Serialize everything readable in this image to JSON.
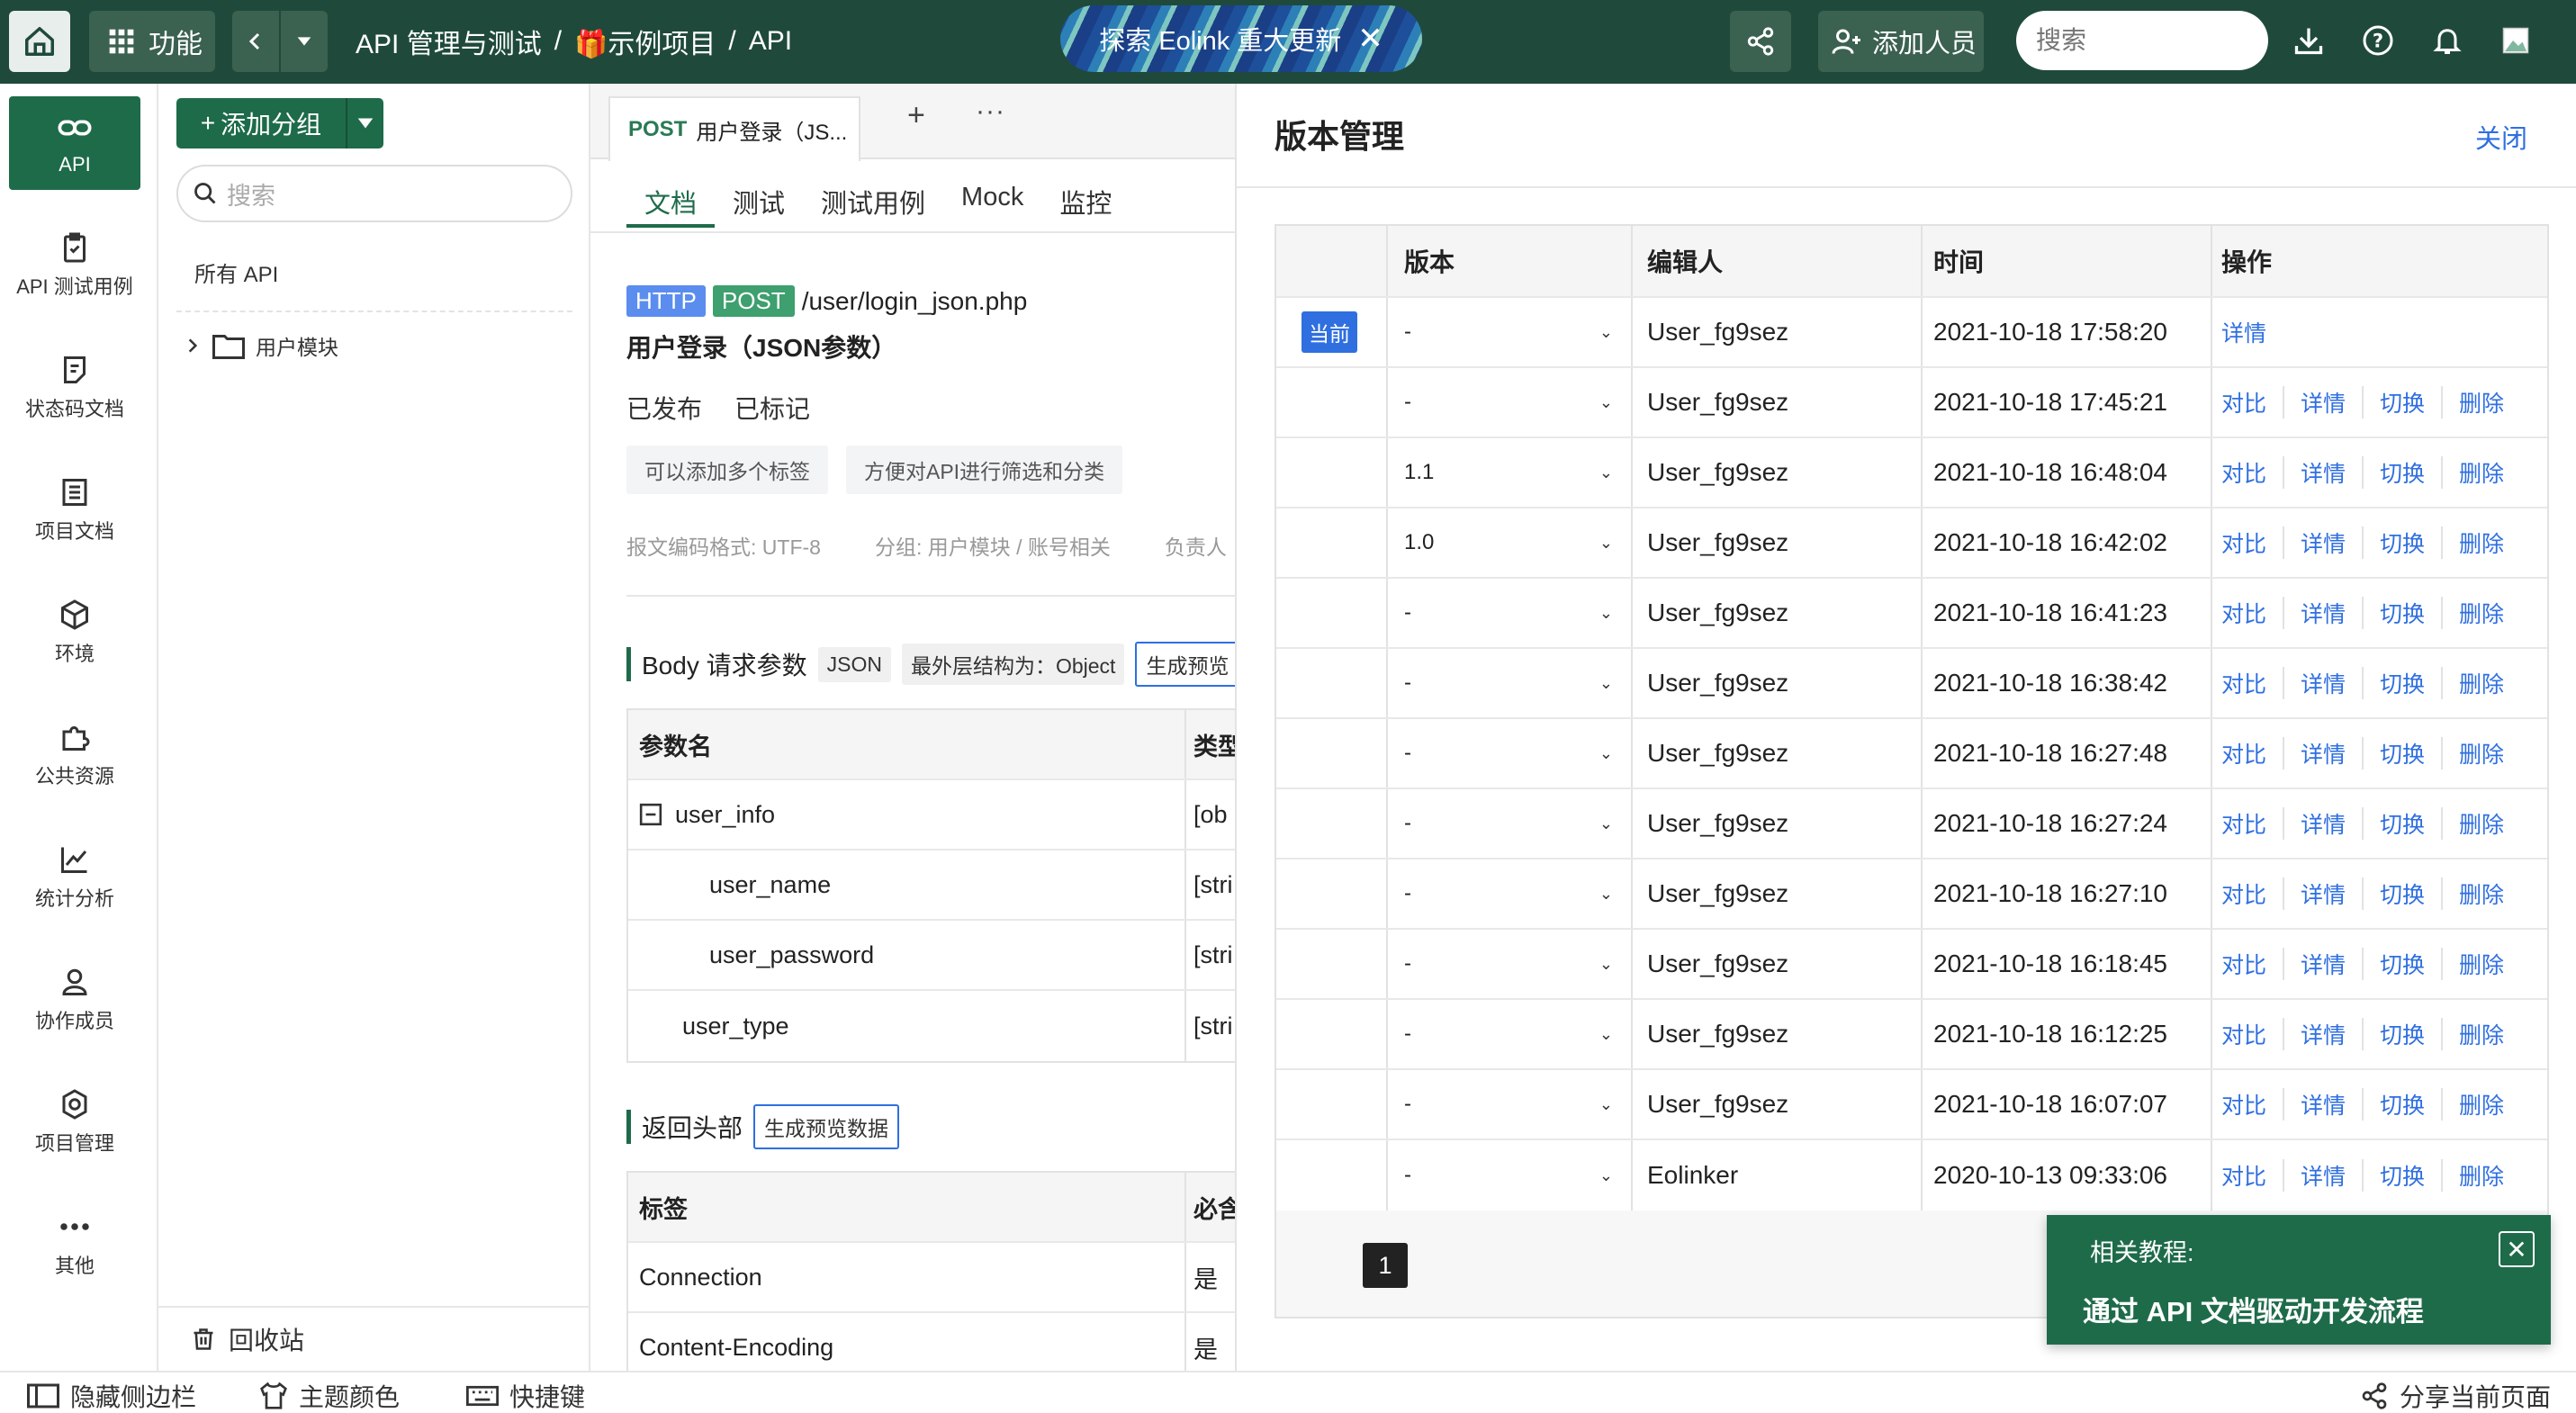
{
  "topbar": {
    "func_label": "功能",
    "breadcrumb": [
      "API 管理与测试",
      "/",
      "🎁示例项目",
      "/",
      "API"
    ],
    "promo": "探索 Eolink 重大更新",
    "add_member": "添加人员",
    "search_placeholder": "搜索",
    "brand_color": "#1f4a3b"
  },
  "rail": {
    "items": [
      {
        "label": "API",
        "icon": "link-icon",
        "active": true
      },
      {
        "label": "API 测试用例",
        "icon": "clipboard-check-icon"
      },
      {
        "label": "状态码文档",
        "icon": "note-icon"
      },
      {
        "label": "项目文档",
        "icon": "document-icon"
      },
      {
        "label": "环境",
        "icon": "cube-icon"
      },
      {
        "label": "公共资源",
        "icon": "puzzle-icon"
      },
      {
        "label": "统计分析",
        "icon": "chart-line-icon"
      },
      {
        "label": "协作成员",
        "icon": "user-icon"
      },
      {
        "label": "项目管理",
        "icon": "gear-icon"
      },
      {
        "label": "其他",
        "icon": "more-icon"
      }
    ]
  },
  "tree": {
    "add_group": "添加分组",
    "search_placeholder": "搜索",
    "all_api": "所有 API",
    "module": "用户模块",
    "recycle": "回收站"
  },
  "doc": {
    "tab_method": "POST",
    "tab_title": "用户登录（JS...",
    "subtabs": [
      "文档",
      "测试",
      "测试用例",
      "Mock",
      "监控"
    ],
    "protocol": "HTTP",
    "method": "POST",
    "path": "/user/login_json.php",
    "title": "用户登录（JSON参数）",
    "status": [
      "已发布",
      "已标记"
    ],
    "tags": [
      "可以添加多个标签",
      "方便对API进行筛选和分类"
    ],
    "meta": [
      "报文编码格式: UTF-8",
      "分组: 用户模块 / 账号相关",
      "负责人"
    ],
    "body_section": {
      "title": "Body 请求参数",
      "chip_json": "JSON",
      "chip_struct": "最外层结构为：Object",
      "chip_preview": "生成预览",
      "headers": [
        "参数名",
        "类型"
      ],
      "rows": [
        {
          "name": "user_info",
          "type": "[ob"
        },
        {
          "name": "user_name",
          "type": "[stri"
        },
        {
          "name": "user_password",
          "type": "[stri"
        },
        {
          "name": "user_type",
          "type": "[stri"
        }
      ]
    },
    "resp_section": {
      "title": "返回头部",
      "chip_preview": "生成预览数据",
      "headers": [
        "标签",
        "必含"
      ],
      "rows": [
        {
          "name": "Connection",
          "req": "是"
        },
        {
          "name": "Content-Encoding",
          "req": "是"
        }
      ]
    }
  },
  "versions": {
    "title": "版本管理",
    "close": "关闭",
    "headers": [
      "",
      "版本",
      "编辑人",
      "时间",
      "操作"
    ],
    "current_badge": "当前",
    "actions": [
      "对比",
      "详情",
      "切换",
      "删除"
    ],
    "current_actions": [
      "详情"
    ],
    "rows": [
      {
        "current": true,
        "version": "-",
        "editor": "User_fg9sez",
        "time": "2021-10-18 17:58:20"
      },
      {
        "version": "-",
        "editor": "User_fg9sez",
        "time": "2021-10-18 17:45:21"
      },
      {
        "version": "1.1",
        "editor": "User_fg9sez",
        "time": "2021-10-18 16:48:04"
      },
      {
        "version": "1.0",
        "editor": "User_fg9sez",
        "time": "2021-10-18 16:42:02"
      },
      {
        "version": "-",
        "editor": "User_fg9sez",
        "time": "2021-10-18 16:41:23"
      },
      {
        "version": "-",
        "editor": "User_fg9sez",
        "time": "2021-10-18 16:38:42"
      },
      {
        "version": "-",
        "editor": "User_fg9sez",
        "time": "2021-10-18 16:27:48"
      },
      {
        "version": "-",
        "editor": "User_fg9sez",
        "time": "2021-10-18 16:27:24"
      },
      {
        "version": "-",
        "editor": "User_fg9sez",
        "time": "2021-10-18 16:27:10"
      },
      {
        "version": "-",
        "editor": "User_fg9sez",
        "time": "2021-10-18 16:18:45"
      },
      {
        "version": "-",
        "editor": "User_fg9sez",
        "time": "2021-10-18 16:12:25"
      },
      {
        "version": "-",
        "editor": "User_fg9sez",
        "time": "2021-10-18 16:07:07"
      },
      {
        "version": "-",
        "editor": "Eolinker",
        "time": "2020-10-13 09:33:06"
      }
    ],
    "page": "1"
  },
  "toast": {
    "label": "相关教程:",
    "link": "通过 API 文档驱动开发流程"
  },
  "bottombar": {
    "hide_sidebar": "隐藏侧边栏",
    "theme": "主题颜色",
    "shortcuts": "快捷键",
    "share": "分享当前页面"
  }
}
